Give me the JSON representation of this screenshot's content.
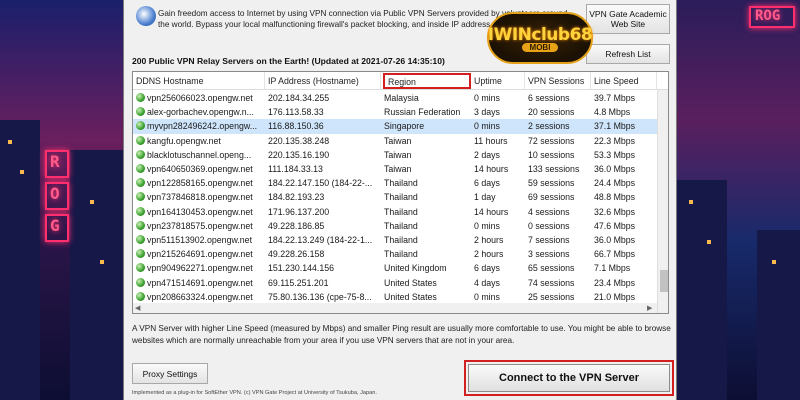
{
  "intro_text": "Gain freedom access to Internet by using VPN connection via Public VPN Servers provided by volunteers around the world. Bypass your local malfunctioning firewall's packet blocking, and inside IP address...",
  "buttons": {
    "academic": "VPN Gate Academic Web Site",
    "refresh": "Refresh List",
    "proxy": "Proxy Settings",
    "connect": "Connect to the VPN Server"
  },
  "servers_title": "200 Public VPN Relay Servers on the Earth! (Updated at 2021-07-26 14:35:10)",
  "table": {
    "columns": [
      "DDNS Hostname",
      "IP Address (Hostname)",
      "Region",
      "Uptime",
      "VPN Sessions",
      "Line Speed"
    ],
    "highlighted_column": "Region",
    "selected_row": 2,
    "rows": [
      [
        "vpn256066023.opengw.net",
        "202.184.34.255",
        "Malaysia",
        "0 mins",
        "6 sessions",
        "39.7 Mbps"
      ],
      [
        "alex-gorbachev.opengw.n...",
        "176.113.58.33",
        "Russian Federation",
        "3 days",
        "20 sessions",
        "4.8 Mbps"
      ],
      [
        "myvpn282496242.opengw...",
        "116.88.150.36",
        "Singapore",
        "0 mins",
        "2 sessions",
        "37.1 Mbps"
      ],
      [
        "kangfu.opengw.net",
        "220.135.38.248",
        "Taiwan",
        "11 hours",
        "72 sessions",
        "22.3 Mbps"
      ],
      [
        "blacklotuschannel.openg...",
        "220.135.16.190",
        "Taiwan",
        "2 days",
        "10 sessions",
        "53.3 Mbps"
      ],
      [
        "vpn640650369.opengw.net",
        "111.184.33.13",
        "Taiwan",
        "14 hours",
        "133 sessions",
        "36.0 Mbps"
      ],
      [
        "vpn122858165.opengw.net",
        "184.22.147.150 (184-22-...",
        "Thailand",
        "6 days",
        "59 sessions",
        "24.4 Mbps"
      ],
      [
        "vpn737846818.opengw.net",
        "184.82.193.23",
        "Thailand",
        "1 day",
        "69 sessions",
        "48.8 Mbps"
      ],
      [
        "vpn164130453.opengw.net",
        "171.96.137.200",
        "Thailand",
        "14 hours",
        "4 sessions",
        "32.6 Mbps"
      ],
      [
        "vpn237818575.opengw.net",
        "49.228.186.85",
        "Thailand",
        "0 mins",
        "0 sessions",
        "47.6 Mbps"
      ],
      [
        "vpn511513902.opengw.net",
        "184.22.13.249 (184-22-1...",
        "Thailand",
        "2 hours",
        "7 sessions",
        "36.0 Mbps"
      ],
      [
        "vpn215264691.opengw.net",
        "49.228.26.158",
        "Thailand",
        "2 hours",
        "3 sessions",
        "66.7 Mbps"
      ],
      [
        "vpn904962271.opengw.net",
        "151.230.144.156",
        "United Kingdom",
        "6 days",
        "65 sessions",
        "7.1 Mbps"
      ],
      [
        "vpn471514691.opengw.net",
        "69.115.251.201",
        "United States",
        "4 days",
        "74 sessions",
        "23.4 Mbps"
      ],
      [
        "vpn208663324.opengw.net",
        "75.80.136.136 (cpe-75-8...",
        "United States",
        "0 mins",
        "25 sessions",
        "21.0 Mbps"
      ]
    ]
  },
  "note": "A VPN Server with higher Line Speed (measured by Mbps) and smaller Ping result are usually more comfortable to use. You might be able to browse websites which are normally unreachable from your area if you use VPN servers that are not in your area.",
  "footer": "Implemented as a plug-in for SoftEther VPN. (c) VPN Gate Project at University of Tsukuba, Japan.",
  "watermark": {
    "main": "IWINclub68",
    "sub": "MOBI"
  },
  "neon": {
    "rog_letters": [
      "R",
      "O",
      "G"
    ],
    "right_sign": "ROG"
  },
  "colors": {
    "highlight_red": "#d21f1f",
    "selected_row": "#cfe5fb",
    "neon_pink": "#ff2f6e"
  }
}
